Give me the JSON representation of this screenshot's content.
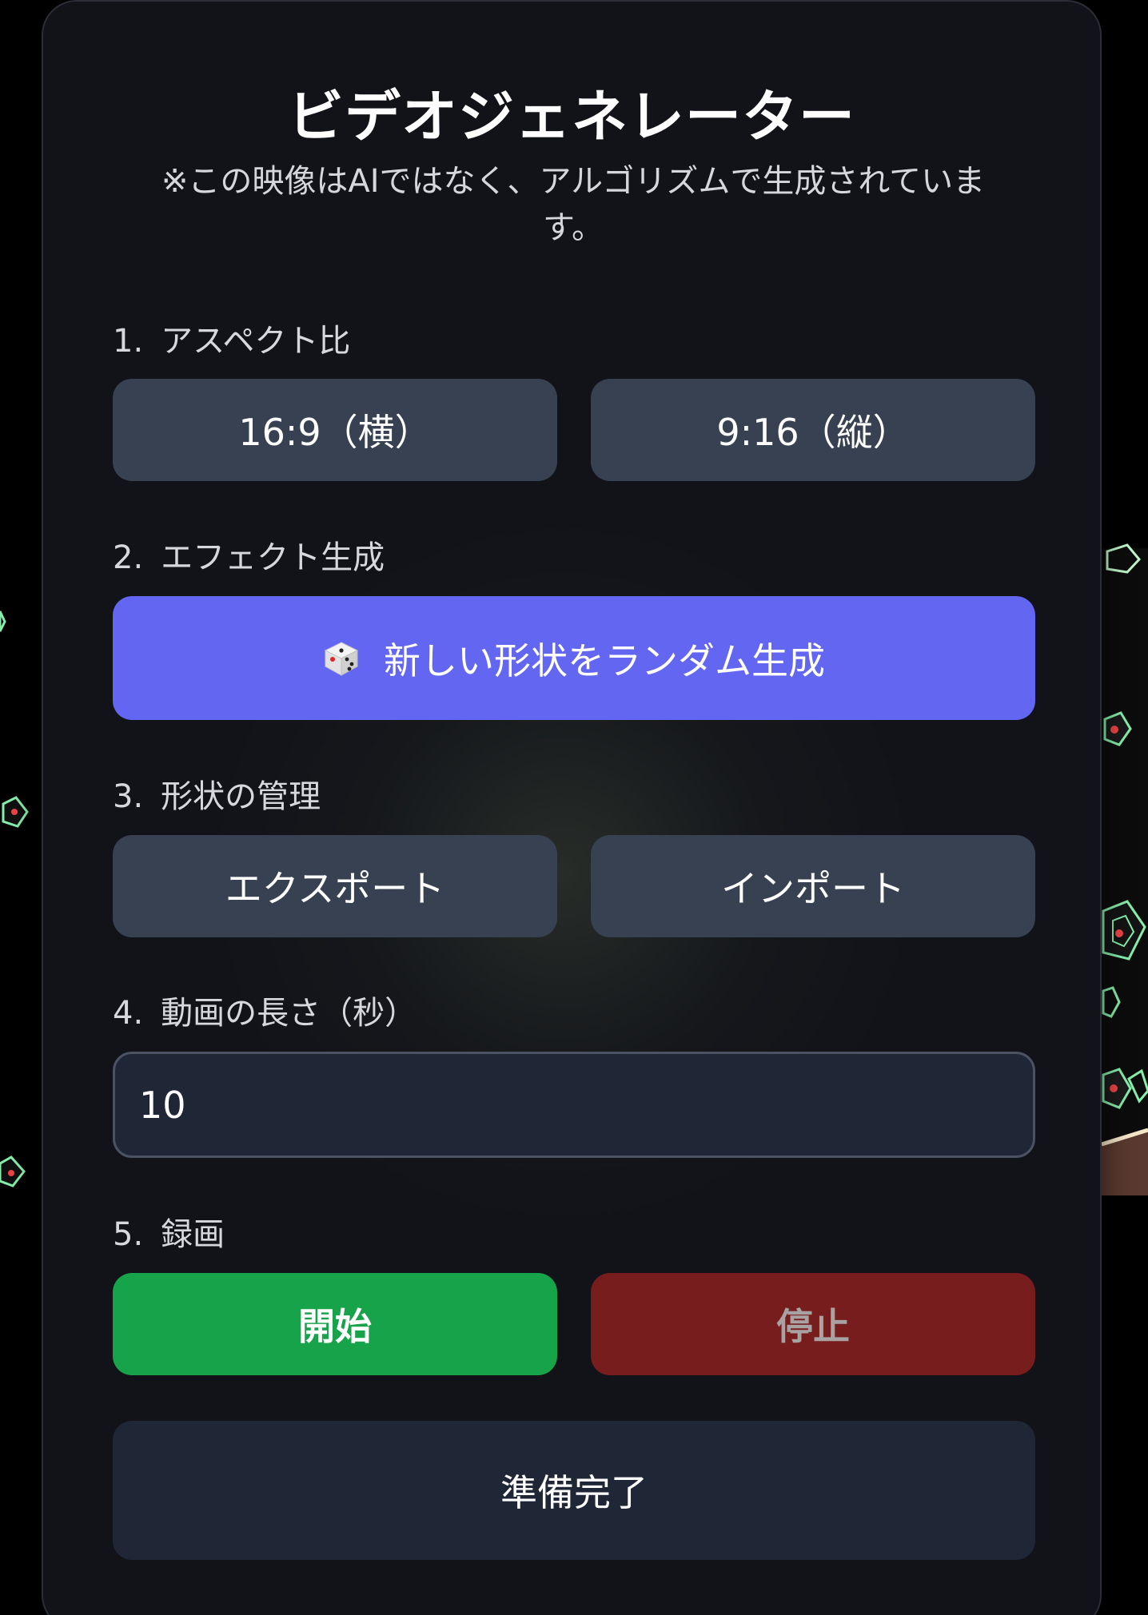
{
  "header": {
    "title": "ビデオジェネレーター",
    "subtitle": "※この映像はAIではなく、アルゴリズムで生成されています。"
  },
  "sections": {
    "aspect": {
      "number": "1.",
      "label": "アスペクト比",
      "landscape_label": "16:9（横）",
      "portrait_label": "9:16（縦）"
    },
    "effect": {
      "number": "2.",
      "label": "エフェクト生成",
      "generate_label": "新しい形状をランダム生成",
      "generate_icon": "dice-icon"
    },
    "shapes": {
      "number": "3.",
      "label": "形状の管理",
      "export_label": "エクスポート",
      "import_label": "インポート"
    },
    "duration": {
      "number": "4.",
      "label": "動画の長さ（秒）",
      "value": "10"
    },
    "record": {
      "number": "5.",
      "label": "録画",
      "start_label": "開始",
      "stop_label": "停止"
    }
  },
  "status": {
    "text": "準備完了"
  },
  "colors": {
    "panel_bg": "#13141b",
    "button_gray": "#374151",
    "button_purple": "#6366f1",
    "button_green": "#16a34a",
    "button_red_disabled": "#771d1d",
    "input_bg": "#1f2737",
    "shape_stroke": "#86efac",
    "shape_fill": "#ef4444"
  }
}
